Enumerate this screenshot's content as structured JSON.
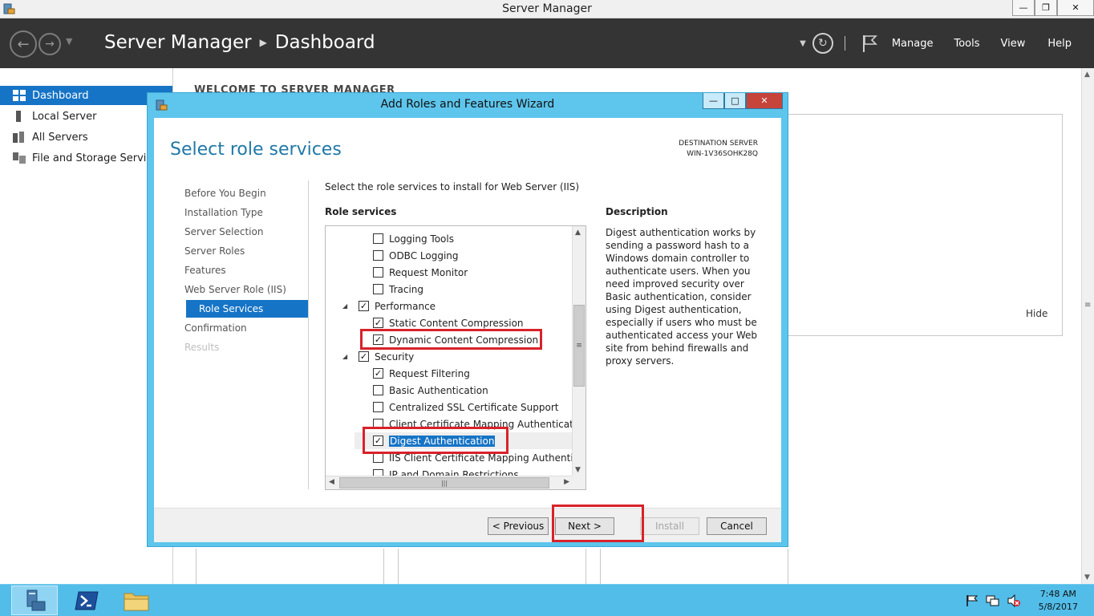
{
  "window": {
    "title": "Server Manager"
  },
  "header": {
    "breadcrumb_root": "Server Manager",
    "breadcrumb_current": "Dashboard",
    "menu": {
      "manage": "Manage",
      "tools": "Tools",
      "view": "View",
      "help": "Help"
    }
  },
  "sidebar": {
    "items": [
      {
        "label": "Dashboard",
        "icon": "dashboard-icon",
        "active": true
      },
      {
        "label": "Local Server",
        "icon": "local-server-icon"
      },
      {
        "label": "All Servers",
        "icon": "all-servers-icon"
      },
      {
        "label": "File and Storage Services",
        "icon": "storage-icon"
      }
    ]
  },
  "main": {
    "welcome_title": "WELCOME TO SERVER MANAGER",
    "hide_label": "Hide"
  },
  "wizard": {
    "title": "Add Roles and Features Wizard",
    "heading": "Select role services",
    "destination_label": "DESTINATION SERVER",
    "destination_name": "WIN-1V36SOHK28Q",
    "steps": [
      {
        "label": "Before You Begin"
      },
      {
        "label": "Installation Type"
      },
      {
        "label": "Server Selection"
      },
      {
        "label": "Server Roles"
      },
      {
        "label": "Features"
      },
      {
        "label": "Web Server Role (IIS)"
      },
      {
        "label": "Role Services",
        "active": true
      },
      {
        "label": "Confirmation"
      },
      {
        "label": "Results",
        "disabled": true
      }
    ],
    "intro": "Select the role services to install for Web Server (IIS)",
    "role_services_label": "Role services",
    "description_label": "Description",
    "description_text": "Digest authentication works by sending a password hash to a Windows domain controller to authenticate users. When you need improved security over Basic authentication, consider using Digest authentication, especially if users who must be authenticated access your Web site from behind firewalls and proxy servers.",
    "tree": [
      {
        "label": "Logging Tools",
        "checked": false,
        "level": 2
      },
      {
        "label": "ODBC Logging",
        "checked": false,
        "level": 2
      },
      {
        "label": "Request Monitor",
        "checked": false,
        "level": 2
      },
      {
        "label": "Tracing",
        "checked": false,
        "level": 2
      },
      {
        "label": "Performance",
        "checked": true,
        "level": 1,
        "expanded": true
      },
      {
        "label": "Static Content Compression",
        "checked": true,
        "level": 2
      },
      {
        "label": "Dynamic Content Compression",
        "checked": true,
        "level": 2
      },
      {
        "label": "Security",
        "checked": true,
        "level": 1,
        "expanded": true
      },
      {
        "label": "Request Filtering",
        "checked": true,
        "level": 2
      },
      {
        "label": "Basic Authentication",
        "checked": false,
        "level": 2
      },
      {
        "label": "Centralized SSL Certificate Support",
        "checked": false,
        "level": 2
      },
      {
        "label": "Client Certificate Mapping Authentication",
        "checked": false,
        "level": 2
      },
      {
        "label": "Digest Authentication",
        "checked": true,
        "level": 2,
        "selected": true
      },
      {
        "label": "IIS Client Certificate Mapping Authentication",
        "checked": false,
        "level": 2
      },
      {
        "label": "IP and Domain Restrictions",
        "checked": false,
        "level": 2
      }
    ],
    "buttons": {
      "previous": "< Previous",
      "next": "Next >",
      "install": "Install",
      "cancel": "Cancel"
    }
  },
  "taskbar": {
    "apps": [
      "server-manager-app-icon",
      "powershell-app-icon",
      "file-explorer-app-icon"
    ],
    "time": "7:48 AM",
    "date": "5/8/2017"
  },
  "colors": {
    "accent": "#1674c6",
    "header_bg": "#343434",
    "wizard_frame": "#5ec5ec",
    "taskbar": "#52bde9",
    "annotation": "#d8222a"
  }
}
